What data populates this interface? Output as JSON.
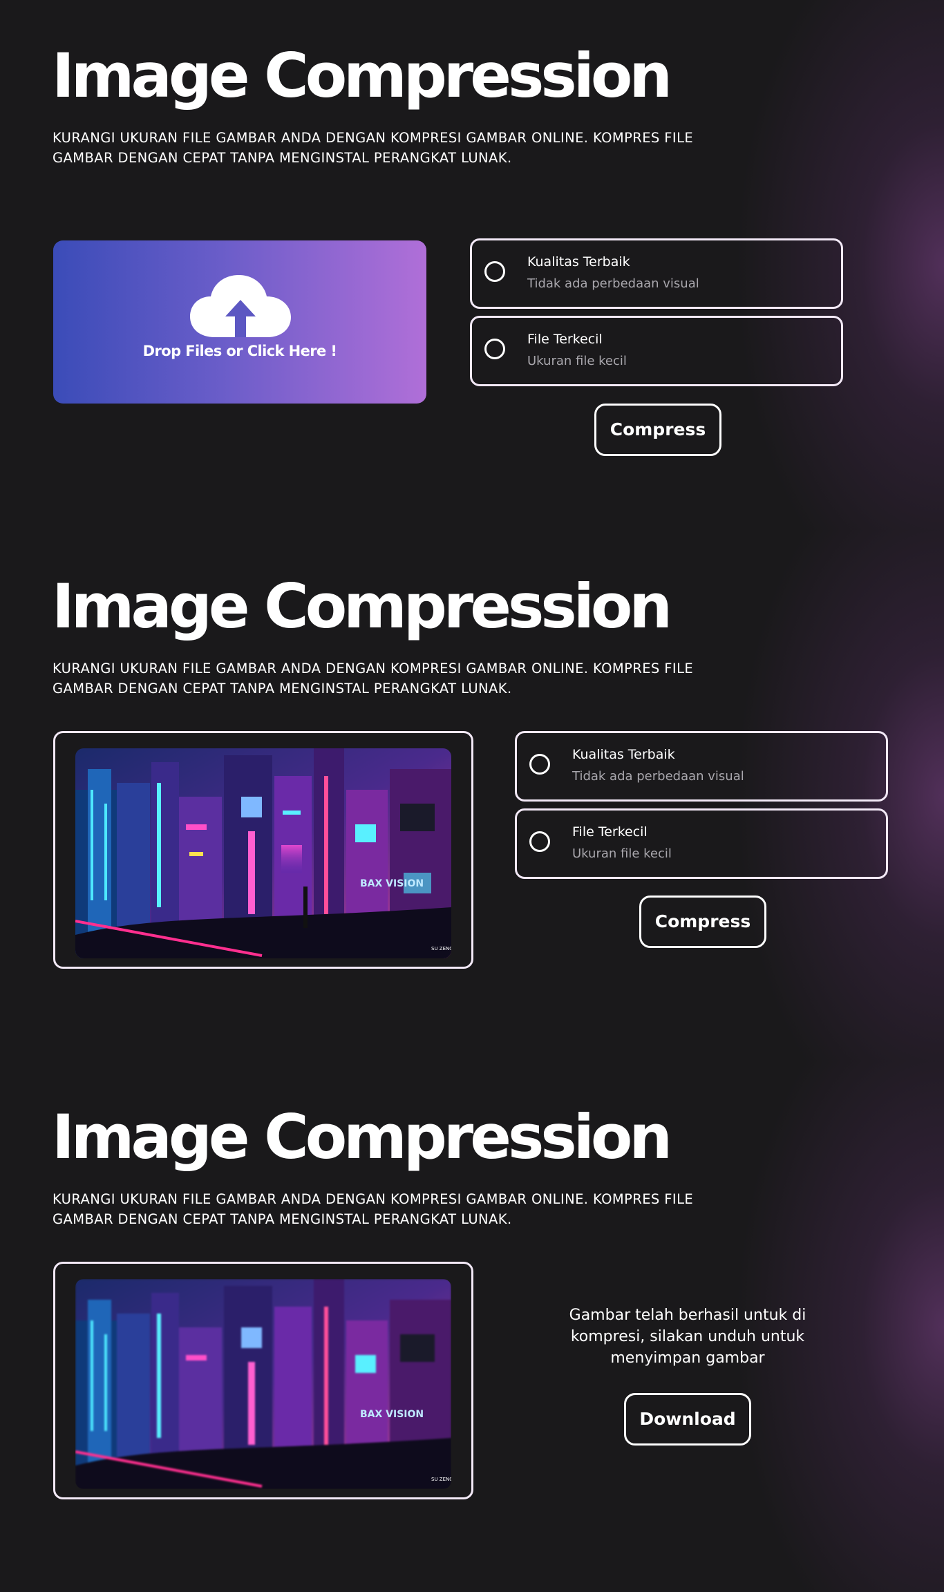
{
  "app": {
    "title": "Image Compression",
    "subtitle": "KURANGI UKURAN FILE GAMBAR ANDA DENGAN KOMPRESI GAMBAR ONLINE. KOMPRES FILE GAMBAR DENGAN CEPAT TANPA MENGINSTAL PERANGKAT LUNAK."
  },
  "upload": {
    "label": "Drop Files or Click Here !",
    "icon": "cloud-upload-icon"
  },
  "options": [
    {
      "title": "Kualitas Terbaik",
      "desc": "Tidak ada perbedaan visual"
    },
    {
      "title": "File Terkecil",
      "desc": "Ukuran file kecil"
    }
  ],
  "actions": {
    "compress_label": "Compress",
    "download_label": "Download"
  },
  "result": {
    "message": "Gambar telah berhasil untuk di kompresi, silakan unduh untuk menyimpan gambar"
  },
  "preview": {
    "watermark": "SU ZENG FAN",
    "sign_text": "BAX VISION"
  },
  "colors": {
    "background": "#1a191b",
    "dropzone_gradient_start": "#3b4cb8",
    "dropzone_gradient_end": "#b06fd8",
    "border": "#f3e9f7",
    "muted_text": "#a9a7ad"
  }
}
